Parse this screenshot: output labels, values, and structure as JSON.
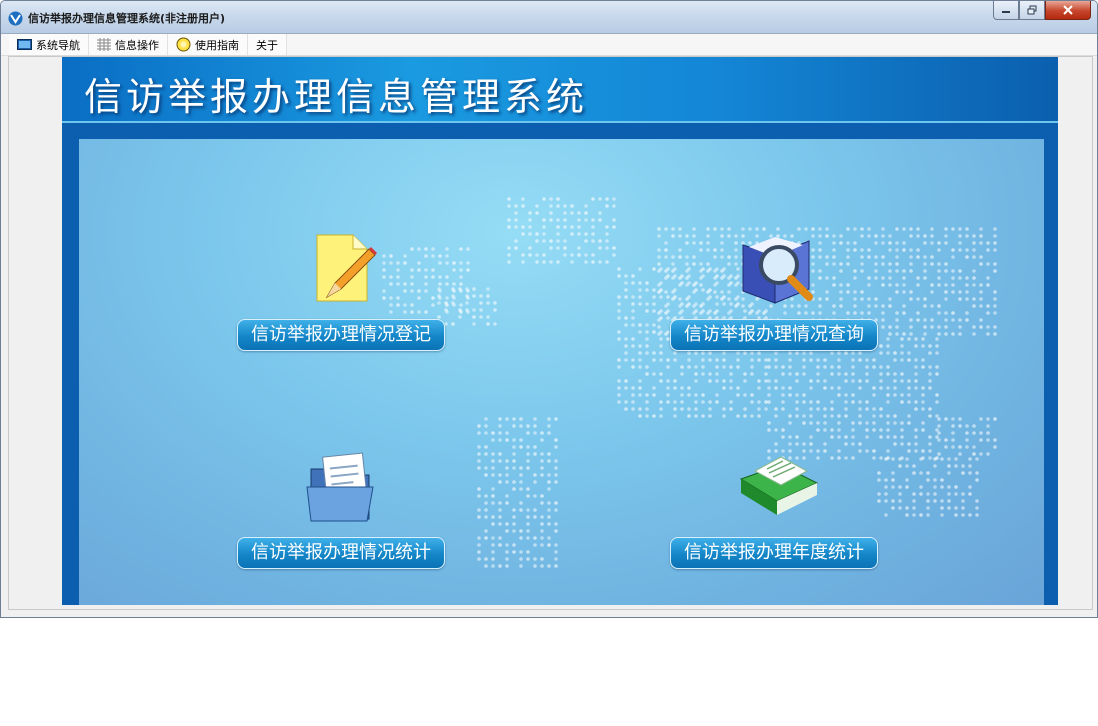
{
  "window": {
    "title": "信访举报办理信息管理系统(非注册用户)",
    "controls": [
      "minimize",
      "restore",
      "close"
    ]
  },
  "menu": {
    "items": [
      {
        "label": "系统导航",
        "icon": "monitor-icon"
      },
      {
        "label": "信息操作",
        "icon": "grid-icon"
      },
      {
        "label": "使用指南",
        "icon": "help-bulb-icon"
      },
      {
        "label": "关于",
        "icon": ""
      }
    ]
  },
  "banner": {
    "title": "信访举报办理信息管理系统"
  },
  "functions": [
    {
      "label": "信访举报办理情况登记",
      "icon": "edit-document-icon"
    },
    {
      "label": "信访举报办理情况查询",
      "icon": "search-book-icon"
    },
    {
      "label": "信访举报办理情况统计",
      "icon": "folder-documents-icon"
    },
    {
      "label": "信访举报办理年度统计",
      "icon": "green-book-icon"
    }
  ],
  "colors": {
    "banner_blue": "#1487d6",
    "panel_blue": "#0b5fae",
    "button_blue": "#1486c8",
    "map_dots": "#ffffff"
  }
}
